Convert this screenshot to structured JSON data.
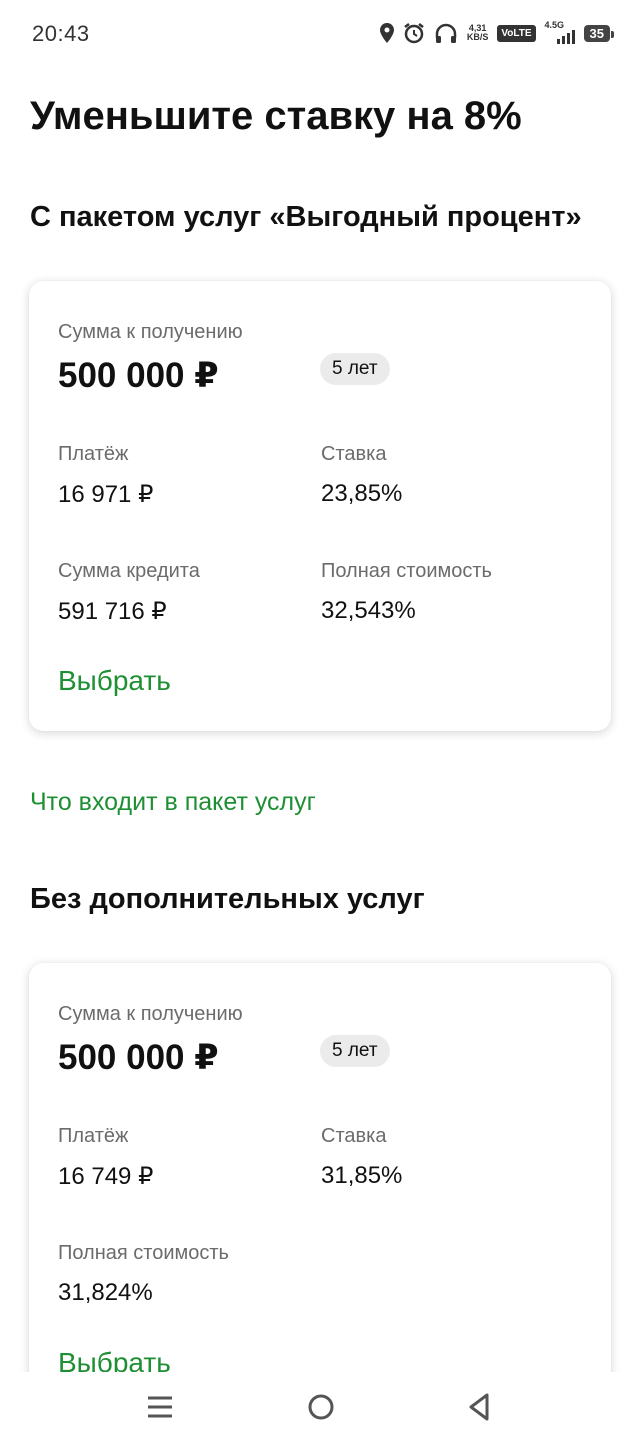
{
  "status_bar": {
    "time": "20:43",
    "net_speed_value": "4,31",
    "net_speed_unit": "KB/S",
    "volte": "VoLTE",
    "network": "4.5G",
    "battery": "35"
  },
  "page": {
    "title": "Уменьшите ставку на 8%"
  },
  "offer_with_package": {
    "section_title": "С пакетом услуг «Выгодный процент»",
    "amount_label": "Сумма к получению",
    "amount_value": "500 000 ₽",
    "term_badge": "5 лет",
    "payment_label": "Платёж",
    "payment_value": "16 971 ₽",
    "rate_label": "Ставка",
    "rate_value": "23,85%",
    "credit_sum_label": "Сумма кредита",
    "credit_sum_value": "591 716 ₽",
    "full_cost_label": "Полная стоимость",
    "full_cost_value": "32,543%",
    "choose_label": "Выбрать"
  },
  "package_link": "Что входит в пакет услуг",
  "offer_without_services": {
    "section_title": "Без дополнительных услуг",
    "amount_label": "Сумма к получению",
    "amount_value": "500 000 ₽",
    "term_badge": "5 лет",
    "payment_label": "Платёж",
    "payment_value": "16 749 ₽",
    "rate_label": "Ставка",
    "rate_value": "31,85%",
    "full_cost_label": "Полная стоимость",
    "full_cost_value": "31,824%",
    "choose_label": "Выбрать"
  },
  "nav_bar": {
    "icons": [
      "menu-icon",
      "home-circle-icon",
      "back-triangle-icon"
    ]
  },
  "colors": {
    "accent_green": "#1f8f34",
    "label_gray": "#6b6b6b",
    "badge_bg": "#ebebeb"
  }
}
